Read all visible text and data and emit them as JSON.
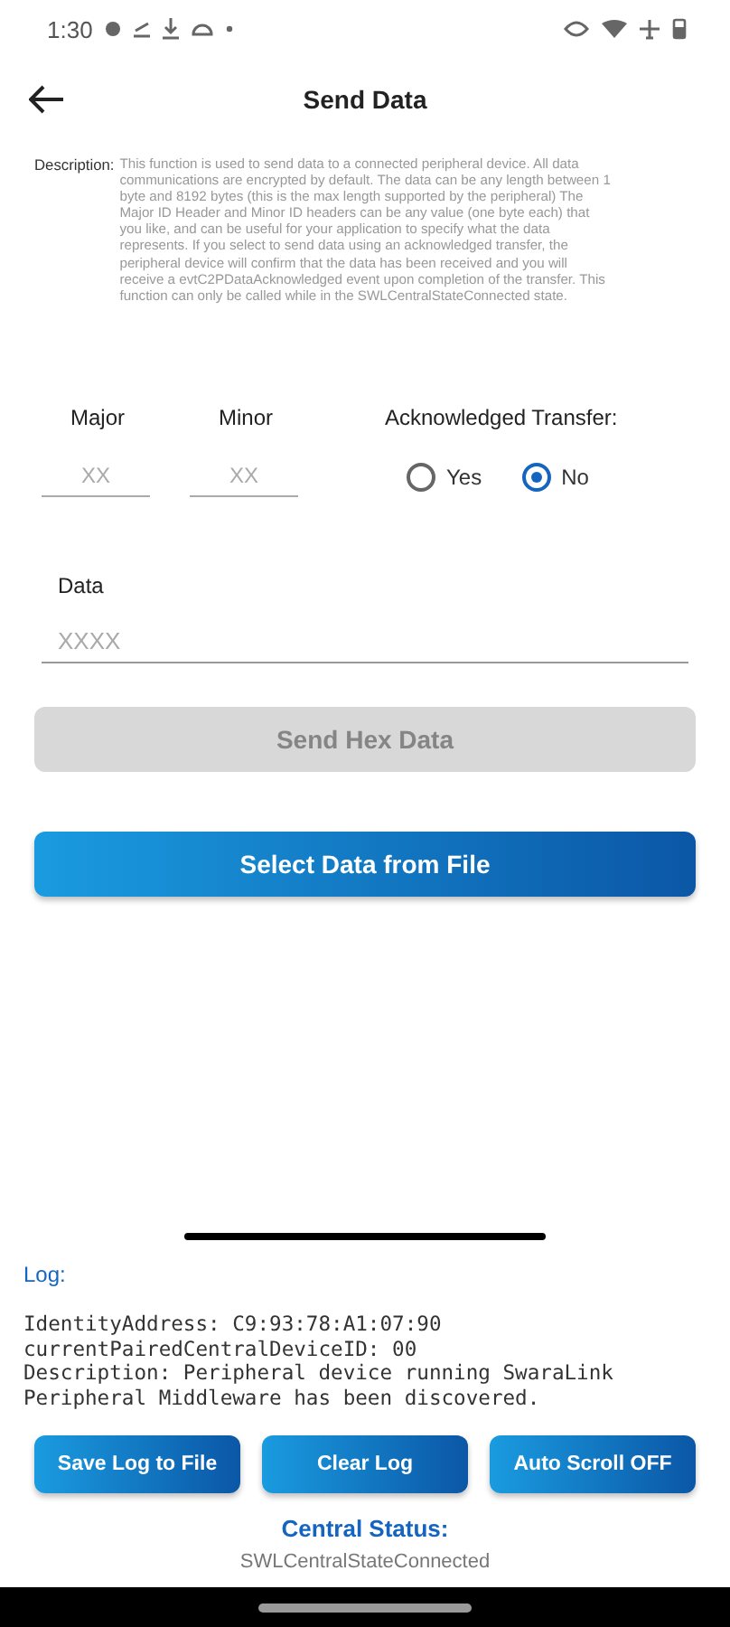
{
  "status_bar": {
    "time": "1:30"
  },
  "header": {
    "title": "Send Data"
  },
  "description": {
    "label": "Description:",
    "text": "This function is used to send data to a connected peripheral device. All data communications are encrypted by default. The data can be any length between 1 byte and 8192 bytes (this is the max length supported by the peripheral) The Major ID Header and Minor ID headers can be any value (one byte each) that you like, and can be useful for your application to specify what the data represents. If you select to send data using an acknowledged transfer, the peripheral device will confirm that the data has been received and you will receive a evtC2PDataAcknowledged event upon completion of the transfer. This function can only be called while in the SWLCentralStateConnected state."
  },
  "major": {
    "label": "Major",
    "placeholder": "XX"
  },
  "minor": {
    "label": "Minor",
    "placeholder": "XX"
  },
  "acknowledged": {
    "label": "Acknowledged Transfer:",
    "options": [
      {
        "label": "Yes",
        "selected": false
      },
      {
        "label": "No",
        "selected": true
      }
    ]
  },
  "data": {
    "label": "Data",
    "placeholder": "XXXX"
  },
  "actions": [
    {
      "label": "Send Hex Data",
      "disabled": true
    },
    {
      "label": "Select Data from File",
      "disabled": false
    }
  ],
  "log": {
    "label": "Log:",
    "lines": [
      "IdentityAddress: C9:93:78:A1:07:90",
      "currentPairedCentralDeviceID: 00",
      "Description: Peripheral device running SwaraLink Peripheral Middleware has been discovered."
    ]
  },
  "log_buttons": [
    "Save Log to File",
    "Clear Log",
    "Auto Scroll OFF"
  ],
  "central_status": {
    "label": "Central Status:",
    "value": "SWLCentralStateConnected"
  }
}
